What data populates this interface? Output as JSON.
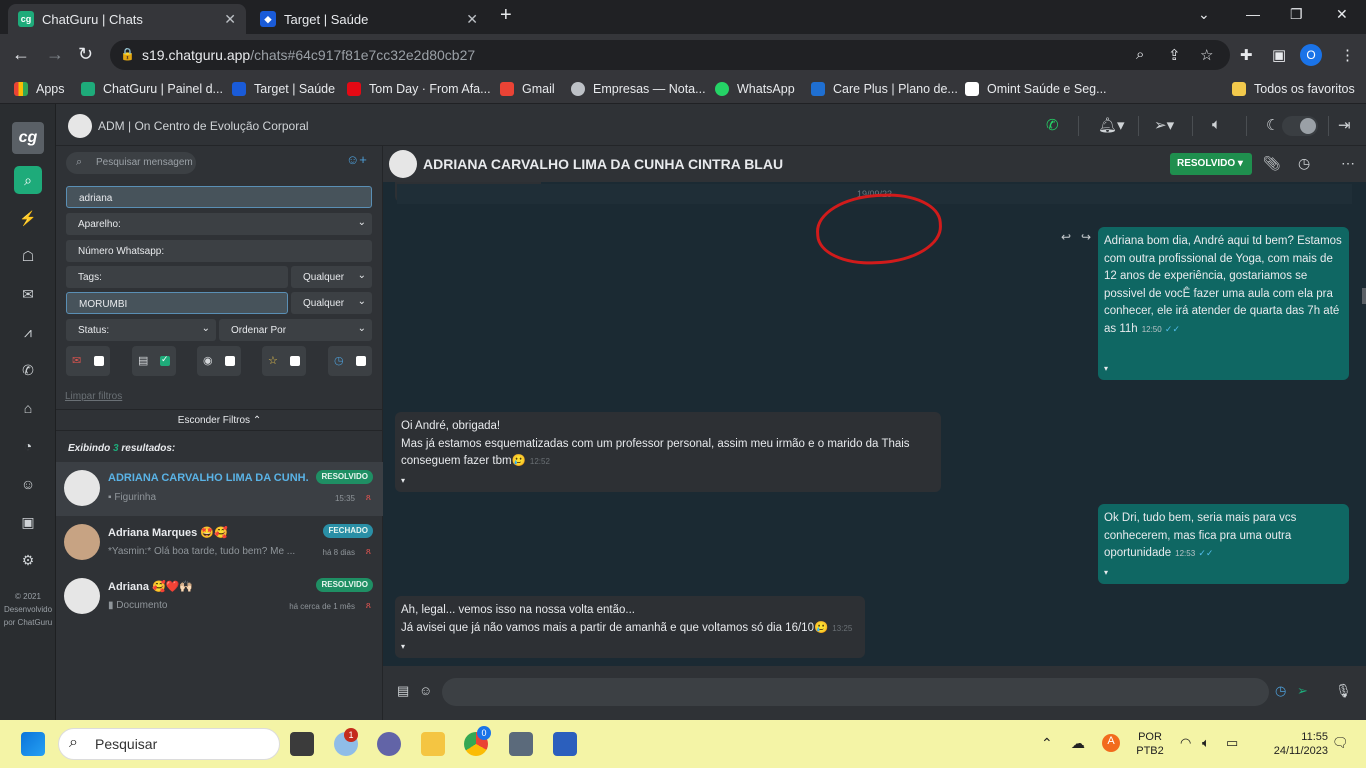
{
  "browser": {
    "tabs": [
      {
        "title": "ChatGuru | Chats",
        "active": true
      },
      {
        "title": "Target | Saúde",
        "active": false
      }
    ],
    "url_host": "s19.chatguru.app",
    "url_path": "/chats#64c917f81e7cc32e2d80cb27",
    "profile_initial": "O",
    "bookmarks": [
      "Apps",
      "ChatGuru | Painel d...",
      "Target | Saúde",
      "Tom Day · From Afa...",
      "Gmail",
      "Empresas — Nota...",
      "WhatsApp",
      "Care Plus | Plano de...",
      "Omint Saúde e Seg..."
    ],
    "all_bookmarks": "Todos os favoritos"
  },
  "app": {
    "logo": "cg",
    "header_title": "ADM | On Centro de Evolução Corporal",
    "copyright": "© 2021 Desenvolvido por ChatGuru",
    "accent": "#1eab7a"
  },
  "sidebar": {
    "search_placeholder": "Pesquisar mensagem",
    "filter_name": "adriana",
    "device": "Aparelho:",
    "whatsapp_number": "Número Whatsapp:",
    "tags": "Tags:",
    "tags_any": "Qualquer",
    "tag_value": "MORUMBI",
    "tag_value_any": "Qualquer",
    "status": "Status:",
    "order_by": "Ordenar Por",
    "clear_filters": "Limpar filtros",
    "hide_filters": "Esconder Filtros",
    "showing_prefix": "Exibindo",
    "showing_count": "3",
    "showing_suffix": "resultados:",
    "chats": [
      {
        "name": "ADRIANA CARVALHO LIMA DA CUNH...",
        "preview": "Figurinha",
        "badge": "RESOLVIDO",
        "time": "15:35"
      },
      {
        "name": "Adriana Marques 🤩🥰",
        "preview": "*Yasmin:* Olá boa tarde, tudo bem? Me ...",
        "badge": "FECHADO",
        "time": "há 8 dias"
      },
      {
        "name": "Adriana 🥰❤️🙌🏻",
        "preview": "Documento",
        "badge": "RESOLVIDO",
        "time": "há cerca de 1 mês"
      }
    ]
  },
  "conversation": {
    "contact_name": "ADRIANA CARVALHO LIMA DA CUNHA CINTRA BLAU",
    "status_label": "RESOLVIDO",
    "date_divider": "19/09/23",
    "messages": [
      {
        "dir": "out",
        "text": "Adriana bom dia, André aqui td bem? Estamos com outra profissional de Yoga, com mais de 12 anos de experiência, gostariamos se possivel de vocÊ fazer uma aula com ela pra conhecer, ele irá atender de quarta das 7h até as 11h",
        "time": "12:50"
      },
      {
        "dir": "in",
        "line1": "Oi André, obrigada!",
        "line2": "Mas já estamos esquematizadas com um professor personal, assim meu irmão e o marido da Thais conseguem fazer tbm🥲",
        "time": "12:52"
      },
      {
        "dir": "out",
        "text": "Ok Dri, tudo bem, seria mais para vcs conhecerem, mas fica pra uma outra oportunidade",
        "time": "12:53"
      },
      {
        "dir": "in",
        "line1": "Ah, legal... vemos isso na nossa volta então...",
        "line2": "Já avisei que já não vamos mais a partir de amanhã e que voltamos só dia 16/10🥲",
        "time": "13:25"
      }
    ]
  },
  "taskbar": {
    "search_placeholder": "Pesquisar",
    "teams_badge": "1",
    "chrome_badge": "0",
    "lang1": "POR",
    "lang2": "PTB2",
    "time": "11:55",
    "date": "24/11/2023"
  }
}
